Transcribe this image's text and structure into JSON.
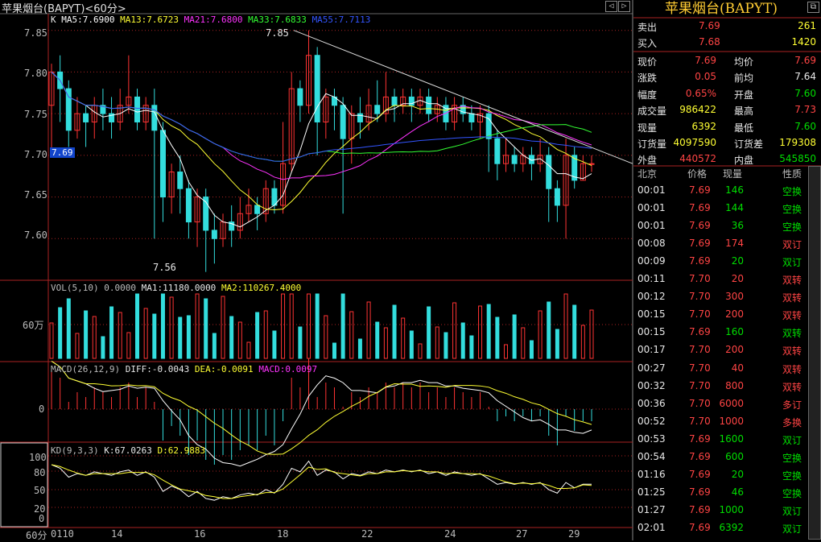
{
  "window": {
    "title": "苹果烟台(BAPYT)<60分>",
    "nav_left": "◁",
    "nav_right": "▷"
  },
  "main_chart": {
    "k_label": "K",
    "ma": [
      {
        "label": "MA5:7.6900",
        "color": "#ffffff"
      },
      {
        "label": "MA13:7.6723",
        "color": "#ffff33"
      },
      {
        "label": "MA21:7.6800",
        "color": "#ff33ff"
      },
      {
        "label": "MA33:7.6833",
        "color": "#33ff33"
      },
      {
        "label": "MA55:7.7113",
        "color": "#3355ff"
      }
    ],
    "y_ticks": [
      "7.85",
      "7.80",
      "7.75",
      "7.70",
      "7.65",
      "7.60"
    ],
    "current_price_tag": "7.69",
    "high_label": "7.85",
    "low_label": "7.56"
  },
  "volume_chart": {
    "label_vol": "VOL(5,10) 0.0000",
    "label_ma1": "MA1:11180.0000",
    "label_ma2": "MA2:110267.4000",
    "y_tick": "60万"
  },
  "macd_chart": {
    "label": "MACD(26,12,9)",
    "diff": "DIFF:-0.0043",
    "dea": "DEA:-0.0091",
    "macd": "MACD:0.0097",
    "y_tick": "0"
  },
  "kd_chart": {
    "label": "KD(9,3,3)",
    "k": "K:67.0263",
    "d": "D:62.9883",
    "y_ticks": [
      "100",
      "80",
      "50",
      "20",
      "0"
    ]
  },
  "x_axis": {
    "unit": "60分",
    "ticks": [
      "0110",
      "14",
      "16",
      "18",
      "22",
      "24",
      "27",
      "29"
    ]
  },
  "quote_panel": {
    "title": "苹果烟台(BAPYT)",
    "sell": {
      "label": "卖出",
      "price": "7.69",
      "vol": "261"
    },
    "buy": {
      "label": "买入",
      "price": "7.68",
      "vol": "1420"
    },
    "rows": [
      {
        "l1": "现价",
        "v1": "7.69",
        "l2": "均价",
        "v2": "7.69",
        "c1": "red",
        "c2": "red"
      },
      {
        "l1": "涨跌",
        "v1": "0.05",
        "l2": "前均",
        "v2": "7.64",
        "c1": "red",
        "c2": "wht"
      },
      {
        "l1": "幅度",
        "v1": "0.65%",
        "l2": "开盘",
        "v2": "7.60",
        "c1": "red",
        "c2": "grn"
      },
      {
        "l1": "成交量",
        "v1": "986422",
        "l2": "最高",
        "v2": "7.73",
        "c1": "yel",
        "c2": "red"
      },
      {
        "l1": "现量",
        "v1": "6392",
        "l2": "最低",
        "v2": "7.60",
        "c1": "yel",
        "c2": "grn"
      },
      {
        "l1": "订货量",
        "v1": "4097590",
        "l2": "订货差",
        "v2": "179308",
        "c1": "yel",
        "c2": "yel"
      },
      {
        "l1": "外盘",
        "v1": "440572",
        "l2": "内盘",
        "v2": "545850",
        "c1": "red",
        "c2": "grn"
      }
    ]
  },
  "ticks_panel": {
    "headers": {
      "time": "北京",
      "price": "价格",
      "vol": "现量",
      "type": "性质"
    },
    "rows": [
      {
        "time": "00:01",
        "price": "7.69",
        "vol": "146",
        "type": "空换",
        "pc": "red",
        "vc": "grn",
        "tc": "grn"
      },
      {
        "time": "00:01",
        "price": "7.69",
        "vol": "144",
        "type": "空换",
        "pc": "red",
        "vc": "grn",
        "tc": "grn"
      },
      {
        "time": "00:01",
        "price": "7.69",
        "vol": "36",
        "type": "空换",
        "pc": "red",
        "vc": "grn",
        "tc": "grn"
      },
      {
        "time": "00:08",
        "price": "7.69",
        "vol": "174",
        "type": "双订",
        "pc": "red",
        "vc": "red",
        "tc": "red"
      },
      {
        "time": "00:09",
        "price": "7.69",
        "vol": "20",
        "type": "双订",
        "pc": "red",
        "vc": "grn",
        "tc": "grn"
      },
      {
        "time": "00:11",
        "price": "7.70",
        "vol": "20",
        "type": "双转",
        "pc": "red",
        "vc": "red",
        "tc": "red"
      },
      {
        "time": "00:12",
        "price": "7.70",
        "vol": "300",
        "type": "双转",
        "pc": "red",
        "vc": "red",
        "tc": "red"
      },
      {
        "time": "00:15",
        "price": "7.70",
        "vol": "200",
        "type": "双转",
        "pc": "red",
        "vc": "red",
        "tc": "red"
      },
      {
        "time": "00:15",
        "price": "7.69",
        "vol": "160",
        "type": "双转",
        "pc": "red",
        "vc": "grn",
        "tc": "grn"
      },
      {
        "time": "00:17",
        "price": "7.70",
        "vol": "200",
        "type": "双转",
        "pc": "red",
        "vc": "red",
        "tc": "red"
      },
      {
        "time": "00:27",
        "price": "7.70",
        "vol": "40",
        "type": "双转",
        "pc": "red",
        "vc": "red",
        "tc": "red"
      },
      {
        "time": "00:32",
        "price": "7.70",
        "vol": "800",
        "type": "双转",
        "pc": "red",
        "vc": "red",
        "tc": "red"
      },
      {
        "time": "00:36",
        "price": "7.70",
        "vol": "6000",
        "type": "多订",
        "pc": "red",
        "vc": "red",
        "tc": "red"
      },
      {
        "time": "00:52",
        "price": "7.70",
        "vol": "1000",
        "type": "多换",
        "pc": "red",
        "vc": "red",
        "tc": "red"
      },
      {
        "time": "00:53",
        "price": "7.69",
        "vol": "1600",
        "type": "双订",
        "pc": "red",
        "vc": "grn",
        "tc": "grn"
      },
      {
        "time": "00:54",
        "price": "7.69",
        "vol": "600",
        "type": "空换",
        "pc": "red",
        "vc": "grn",
        "tc": "grn"
      },
      {
        "time": "01:16",
        "price": "7.69",
        "vol": "20",
        "type": "空换",
        "pc": "red",
        "vc": "grn",
        "tc": "grn"
      },
      {
        "time": "01:25",
        "price": "7.69",
        "vol": "46",
        "type": "空换",
        "pc": "red",
        "vc": "grn",
        "tc": "grn"
      },
      {
        "time": "01:27",
        "price": "7.69",
        "vol": "1000",
        "type": "双订",
        "pc": "red",
        "vc": "grn",
        "tc": "grn"
      },
      {
        "time": "02:01",
        "price": "7.69",
        "vol": "6392",
        "type": "双订",
        "pc": "red",
        "vc": "grn",
        "tc": "grn"
      }
    ]
  },
  "colors": {
    "up": "#ff3333",
    "down": "#33dddd",
    "grid": "#aa2222",
    "bg": "#000000",
    "accent": "#ffcc33"
  },
  "chart_data": {
    "type": "candlestick",
    "ylim": [
      7.55,
      7.87
    ],
    "candles": [
      [
        7.76,
        7.8,
        7.81,
        7.7
      ],
      [
        7.8,
        7.78,
        7.82,
        7.74
      ],
      [
        7.78,
        7.73,
        7.79,
        7.71
      ],
      [
        7.73,
        7.75,
        7.77,
        7.72
      ],
      [
        7.75,
        7.74,
        7.76,
        7.71
      ],
      [
        7.74,
        7.76,
        7.77,
        7.72
      ],
      [
        7.76,
        7.75,
        7.78,
        7.73
      ],
      [
        7.75,
        7.74,
        7.77,
        7.72
      ],
      [
        7.74,
        7.76,
        7.78,
        7.73
      ],
      [
        7.76,
        7.77,
        7.82,
        7.75
      ],
      [
        7.77,
        7.74,
        7.78,
        7.73
      ],
      [
        7.74,
        7.76,
        7.77,
        7.73
      ],
      [
        7.76,
        7.73,
        7.78,
        7.6
      ],
      [
        7.73,
        7.65,
        7.74,
        7.62
      ],
      [
        7.65,
        7.68,
        7.69,
        7.63
      ],
      [
        7.68,
        7.66,
        7.7,
        7.63
      ],
      [
        7.66,
        7.62,
        7.67,
        7.6
      ],
      [
        7.62,
        7.65,
        7.66,
        7.59
      ],
      [
        7.65,
        7.61,
        7.66,
        7.56
      ],
      [
        7.61,
        7.6,
        7.63,
        7.57
      ],
      [
        7.6,
        7.62,
        7.63,
        7.59
      ],
      [
        7.62,
        7.61,
        7.64,
        7.59
      ],
      [
        7.61,
        7.63,
        7.65,
        7.6
      ],
      [
        7.63,
        7.64,
        7.66,
        7.62
      ],
      [
        7.64,
        7.63,
        7.65,
        7.61
      ],
      [
        7.63,
        7.66,
        7.67,
        7.62
      ],
      [
        7.66,
        7.64,
        7.67,
        7.63
      ],
      [
        7.64,
        7.69,
        7.74,
        7.63
      ],
      [
        7.69,
        7.78,
        7.8,
        7.68
      ],
      [
        7.78,
        7.76,
        7.79,
        7.74
      ],
      [
        7.76,
        7.82,
        7.85,
        7.75
      ],
      [
        7.82,
        7.74,
        7.83,
        7.7
      ],
      [
        7.74,
        7.77,
        7.78,
        7.72
      ],
      [
        7.77,
        7.76,
        7.78,
        7.73
      ],
      [
        7.76,
        7.72,
        7.77,
        7.63
      ],
      [
        7.72,
        7.75,
        7.76,
        7.69
      ],
      [
        7.75,
        7.74,
        7.77,
        7.72
      ],
      [
        7.74,
        7.76,
        7.78,
        7.73
      ],
      [
        7.76,
        7.75,
        7.79,
        7.74
      ],
      [
        7.75,
        7.77,
        7.8,
        7.74
      ],
      [
        7.77,
        7.76,
        7.78,
        7.74
      ],
      [
        7.76,
        7.77,
        7.78,
        7.75
      ],
      [
        7.77,
        7.76,
        7.78,
        7.74
      ],
      [
        7.76,
        7.77,
        7.78,
        7.75
      ],
      [
        7.77,
        7.75,
        7.78,
        7.74
      ],
      [
        7.75,
        7.76,
        7.77,
        7.74
      ],
      [
        7.76,
        7.74,
        7.77,
        7.73
      ],
      [
        7.74,
        7.76,
        7.77,
        7.73
      ],
      [
        7.76,
        7.75,
        7.77,
        7.74
      ],
      [
        7.75,
        7.74,
        7.76,
        7.73
      ],
      [
        7.74,
        7.75,
        7.76,
        7.72
      ],
      [
        7.75,
        7.72,
        7.76,
        7.68
      ],
      [
        7.72,
        7.69,
        7.73,
        7.67
      ],
      [
        7.69,
        7.7,
        7.72,
        7.68
      ],
      [
        7.7,
        7.69,
        7.71,
        7.68
      ],
      [
        7.69,
        7.7,
        7.71,
        7.68
      ],
      [
        7.7,
        7.69,
        7.71,
        7.67
      ],
      [
        7.69,
        7.7,
        7.72,
        7.68
      ],
      [
        7.7,
        7.66,
        7.71,
        7.62
      ],
      [
        7.66,
        7.64,
        7.67,
        7.62
      ],
      [
        7.64,
        7.7,
        7.72,
        7.6
      ],
      [
        7.7,
        7.67,
        7.71,
        7.66
      ],
      [
        7.67,
        7.69,
        7.7,
        7.67
      ],
      [
        7.69,
        7.69,
        7.7,
        7.68
      ]
    ]
  }
}
